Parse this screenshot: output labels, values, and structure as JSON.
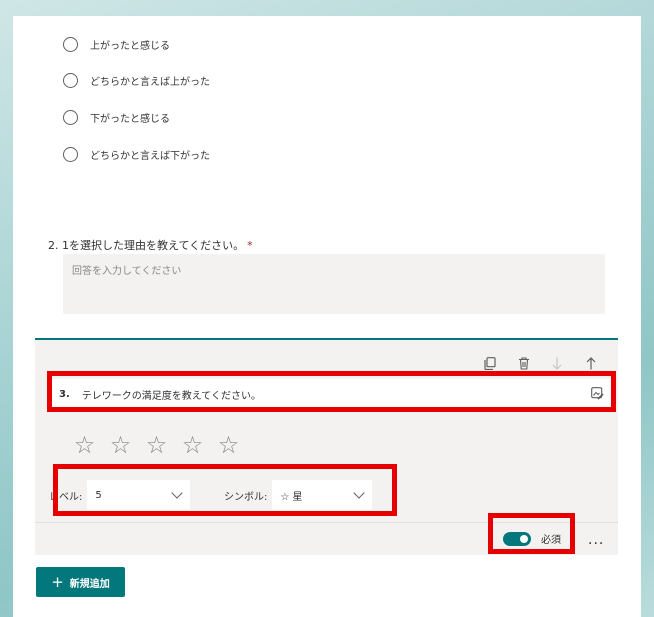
{
  "q1": {
    "options": [
      "上がったと感じる",
      "どちらかと言えば上がった",
      "下がったと感じる",
      "どちらかと言えば下がった"
    ]
  },
  "q2": {
    "title": "2. 1を選択した理由を教えてください。",
    "required_mark": "*",
    "placeholder": "回答を入力してください"
  },
  "q3": {
    "toolbar": [
      "copy-icon",
      "delete-icon",
      "move-down-icon",
      "move-up-icon"
    ],
    "number": "3.",
    "title": "テレワークの満足度を教えてください。",
    "star_glyph": "☆",
    "star_count": 5,
    "level_label": "レベル:",
    "level_value": "5",
    "symbol_label": "シンボル:",
    "symbol_value": "☆ 星",
    "required_label": "必須",
    "more_label": "···",
    "required_on": true
  },
  "add_button": {
    "icon": "+",
    "label": "新規追加"
  },
  "colors": {
    "accent": "#03787c",
    "highlight": "#e60000",
    "required_star": "#a4262c"
  }
}
